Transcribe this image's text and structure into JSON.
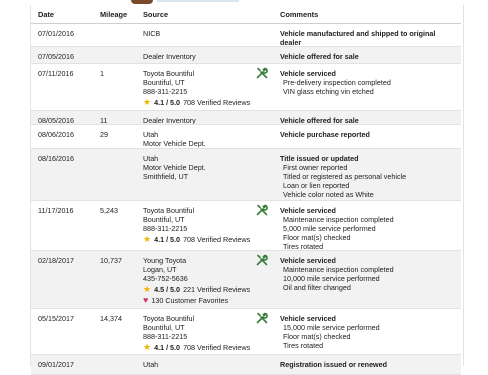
{
  "columns": {
    "date": "Date",
    "mileage": "Mileage",
    "source": "Source",
    "comments": "Comments"
  },
  "rows": [
    {
      "date": "07/01/2016",
      "mileage": "",
      "source": [
        "NICB"
      ],
      "rating": null,
      "favorites": null,
      "serviced": false,
      "comments_title": "Vehicle manufactured and shipped to original dealer",
      "comments_items": []
    },
    {
      "date": "07/05/2016",
      "mileage": "",
      "source": [
        "Dealer Inventory"
      ],
      "rating": null,
      "favorites": null,
      "serviced": false,
      "comments_title": "Vehicle offered for sale",
      "comments_items": []
    },
    {
      "date": "07/11/2016",
      "mileage": "1",
      "source": [
        "Toyota Bountiful",
        "Bountiful, UT",
        "888-311-2215"
      ],
      "rating": {
        "score": "4.1 / 5.0",
        "reviews": "708 Verified Reviews"
      },
      "favorites": null,
      "serviced": true,
      "comments_title": "Vehicle serviced",
      "comments_items": [
        "Pre-delivery inspection completed",
        "VIN glass etching vin etched"
      ]
    },
    {
      "date": "08/05/2016",
      "mileage": "11",
      "source": [
        "Dealer Inventory"
      ],
      "rating": null,
      "favorites": null,
      "serviced": false,
      "comments_title": "Vehicle offered for sale",
      "comments_items": []
    },
    {
      "date": "08/06/2016",
      "mileage": "29",
      "source": [
        "Utah",
        "Motor Vehicle Dept."
      ],
      "rating": null,
      "favorites": null,
      "serviced": false,
      "comments_title": "Vehicle purchase reported",
      "comments_items": []
    },
    {
      "date": "08/16/2016",
      "mileage": "",
      "source": [
        "Utah",
        "Motor Vehicle Dept.",
        "Smithfield, UT"
      ],
      "rating": null,
      "favorites": null,
      "serviced": false,
      "comments_title": "Title issued or updated",
      "comments_items": [
        "First owner reported",
        "Titled or registered as personal vehicle",
        "Loan or lien reported",
        "Vehicle color noted as White"
      ]
    },
    {
      "date": "11/17/2016",
      "mileage": "5,243",
      "source": [
        "Toyota Bountiful",
        "Bountiful, UT",
        "888-311-2215"
      ],
      "rating": {
        "score": "4.1 / 5.0",
        "reviews": "708 Verified Reviews"
      },
      "favorites": null,
      "serviced": true,
      "comments_title": "Vehicle serviced",
      "comments_items": [
        "Maintenance inspection completed",
        "5,000 mile service performed",
        "Floor mat(s) checked",
        "Tires rotated"
      ]
    },
    {
      "date": "02/18/2017",
      "mileage": "10,737",
      "source": [
        "Young Toyota",
        "Logan, UT",
        "435-752-5636"
      ],
      "rating": {
        "score": "4.5 / 5.0",
        "reviews": "221 Verified Reviews"
      },
      "favorites": "130 Customer Favorites",
      "serviced": true,
      "comments_title": "Vehicle serviced",
      "comments_items": [
        "Maintenance inspection completed",
        "10,000 mile service performed",
        "Oil and filter changed"
      ]
    },
    {
      "date": "05/15/2017",
      "mileage": "14,374",
      "source": [
        "Toyota Bountiful",
        "Bountiful, UT",
        "888-311-2215"
      ],
      "rating": {
        "score": "4.1 / 5.0",
        "reviews": "708 Verified Reviews"
      },
      "favorites": null,
      "serviced": true,
      "comments_title": "Vehicle serviced",
      "comments_items": [
        "15,000 mile service performed",
        "Floor mat(s) checked",
        "Tires rotated"
      ]
    },
    {
      "date": "09/01/2017",
      "mileage": "",
      "source": [
        "Utah"
      ],
      "rating": null,
      "favorites": null,
      "serviced": false,
      "comments_title": "Registration issued or renewed",
      "comments_items": []
    }
  ],
  "colors": {
    "star": "#f2b400",
    "heart": "#d6336c",
    "wrench": "#3a7d3a",
    "row_alt": "#f2f2f2"
  },
  "icons": {
    "service": "wrench-icon",
    "rating": "star-icon",
    "favorites": "heart-icon"
  }
}
